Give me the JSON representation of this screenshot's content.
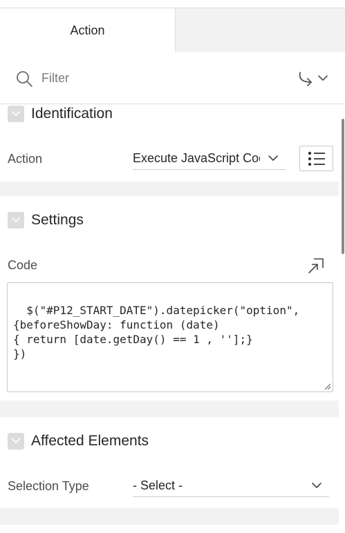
{
  "tabs": {
    "active_label": "Action"
  },
  "filter": {
    "placeholder": "Filter",
    "search_icon": "search-icon",
    "goto_icon": "go-to-group-icon"
  },
  "sections": {
    "identification": {
      "title": "Identification",
      "action_label": "Action",
      "action_value": "Execute JavaScript Code",
      "list_icon": "list-icon"
    },
    "settings": {
      "title": "Settings",
      "code_label": "Code",
      "code_value": "$(\"#P12_START_DATE\").datepicker(\"option\",\n{beforeShowDay: function (date)\n{ return [date.getDay() == 1 , ''];}\n})",
      "expand_icon": "open-code-editor-icon"
    },
    "affected_elements": {
      "title": "Affected Elements",
      "selection_type_label": "Selection Type",
      "selection_type_value": "- Select -"
    }
  },
  "colors": {
    "tab_inactive_bg": "#f2f2f2",
    "band_bg": "#f2f2f2",
    "collapse_btn_bg": "#dcdcdc",
    "text": "#262626",
    "label": "#4d4d4d"
  }
}
